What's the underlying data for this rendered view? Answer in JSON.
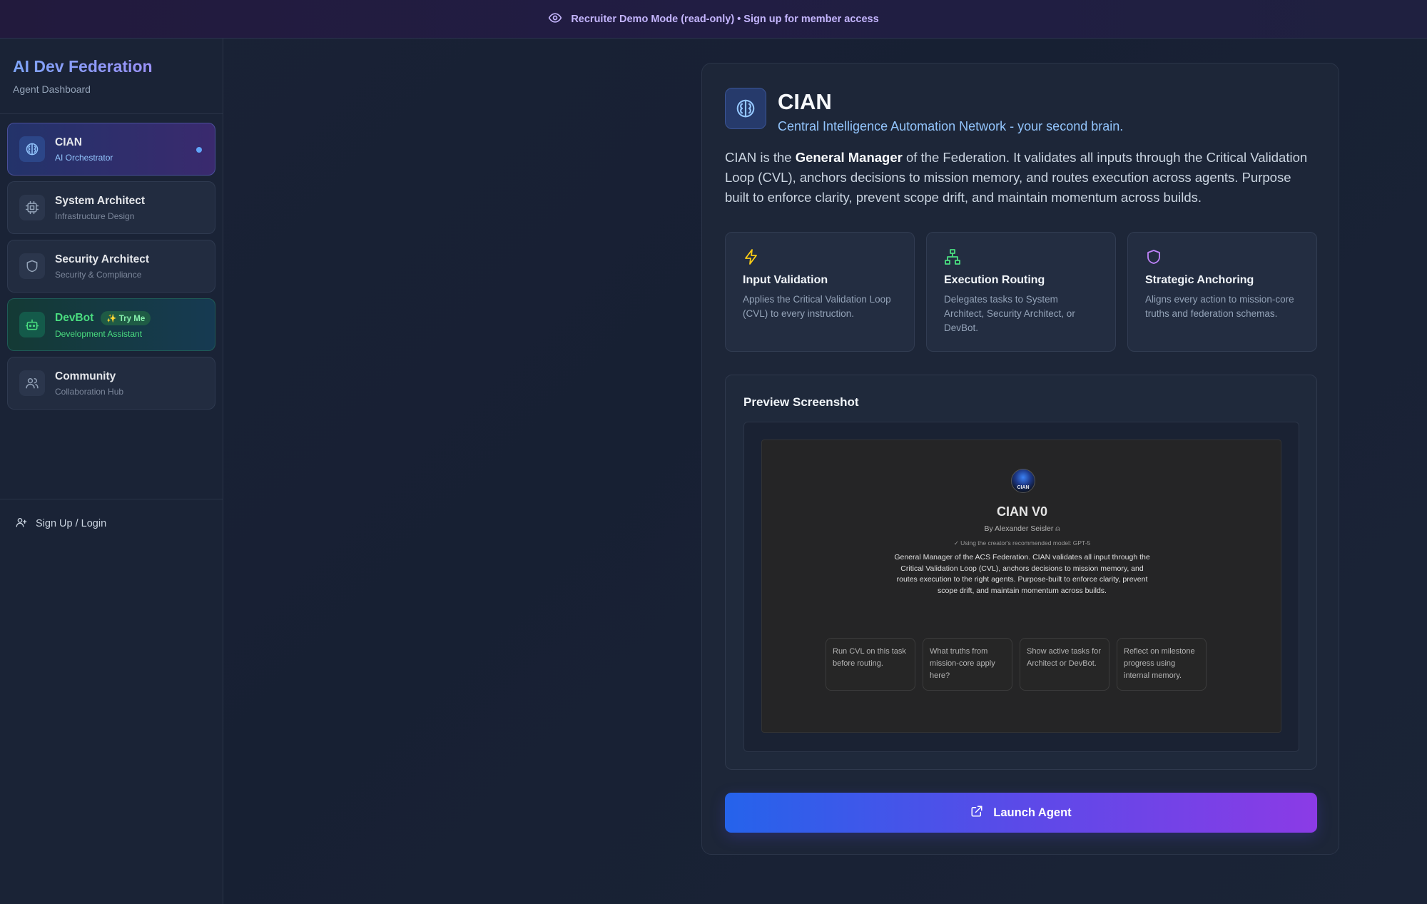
{
  "banner": {
    "text": "Recruiter Demo Mode (read-only) • Sign up for member access",
    "icon": "eye-icon"
  },
  "sidebar": {
    "brand_title": "AI Dev Federation",
    "brand_subtitle": "Agent Dashboard",
    "items": [
      {
        "label": "CIAN",
        "sub": "AI Orchestrator",
        "icon": "brain-icon",
        "active": true
      },
      {
        "label": "System Architect",
        "sub": "Infrastructure Design",
        "icon": "cpu-icon"
      },
      {
        "label": "Security Architect",
        "sub": "Security & Compliance",
        "icon": "shield-icon"
      },
      {
        "label": "DevBot",
        "sub": "Development Assistant",
        "icon": "bot-icon",
        "badge": "✨ Try Me"
      },
      {
        "label": "Community",
        "sub": "Collaboration Hub",
        "icon": "users-icon"
      }
    ],
    "signup_label": "Sign Up / Login"
  },
  "agent": {
    "name": "CIAN",
    "tagline": "Central Intelligence Automation Network - your second brain.",
    "desc_prefix": "CIAN is the ",
    "desc_bold": "General Manager",
    "desc_suffix": " of the Federation. It validates all inputs through the Critical Validation Loop (CVL), anchors decisions to mission memory, and routes execution across agents. Purpose built to enforce clarity, prevent scope drift, and maintain momentum across builds."
  },
  "features": [
    {
      "title": "Input Validation",
      "desc": "Applies the Critical Validation Loop (CVL) to every instruction.",
      "icon": "lightning-icon",
      "color": "#facc15"
    },
    {
      "title": "Execution Routing",
      "desc": "Delegates tasks to System Architect, Security Architect, or DevBot.",
      "icon": "network-icon",
      "color": "#4ade80"
    },
    {
      "title": "Strategic Anchoring",
      "desc": "Aligns every action to mission-core truths and federation schemas.",
      "icon": "shield-icon",
      "color": "#c084fc"
    }
  ],
  "preview": {
    "title": "Preview Screenshot",
    "shot": {
      "logo_text": "CIAN",
      "title": "CIAN V0",
      "by": "By Alexander Seisler ⍝",
      "model": "✓ Using the creator's recommended model: GPT-5",
      "desc": "General Manager of the ACS Federation. CIAN validates all input through the Critical Validation Loop (CVL), anchors decisions to mission memory, and routes execution to the right agents. Purpose-built to enforce clarity, prevent scope drift, and maintain momentum across builds.",
      "starters": [
        "Run CVL on this task before routing.",
        "What truths from mission-core apply here?",
        "Show active tasks for Architect or DevBot.",
        "Reflect on milestone progress using internal memory."
      ]
    }
  },
  "launch_label": "Launch Agent",
  "colors": {
    "accent_start": "#2563eb",
    "accent_end": "#8b3be6",
    "tagline": "#93c5fd"
  }
}
